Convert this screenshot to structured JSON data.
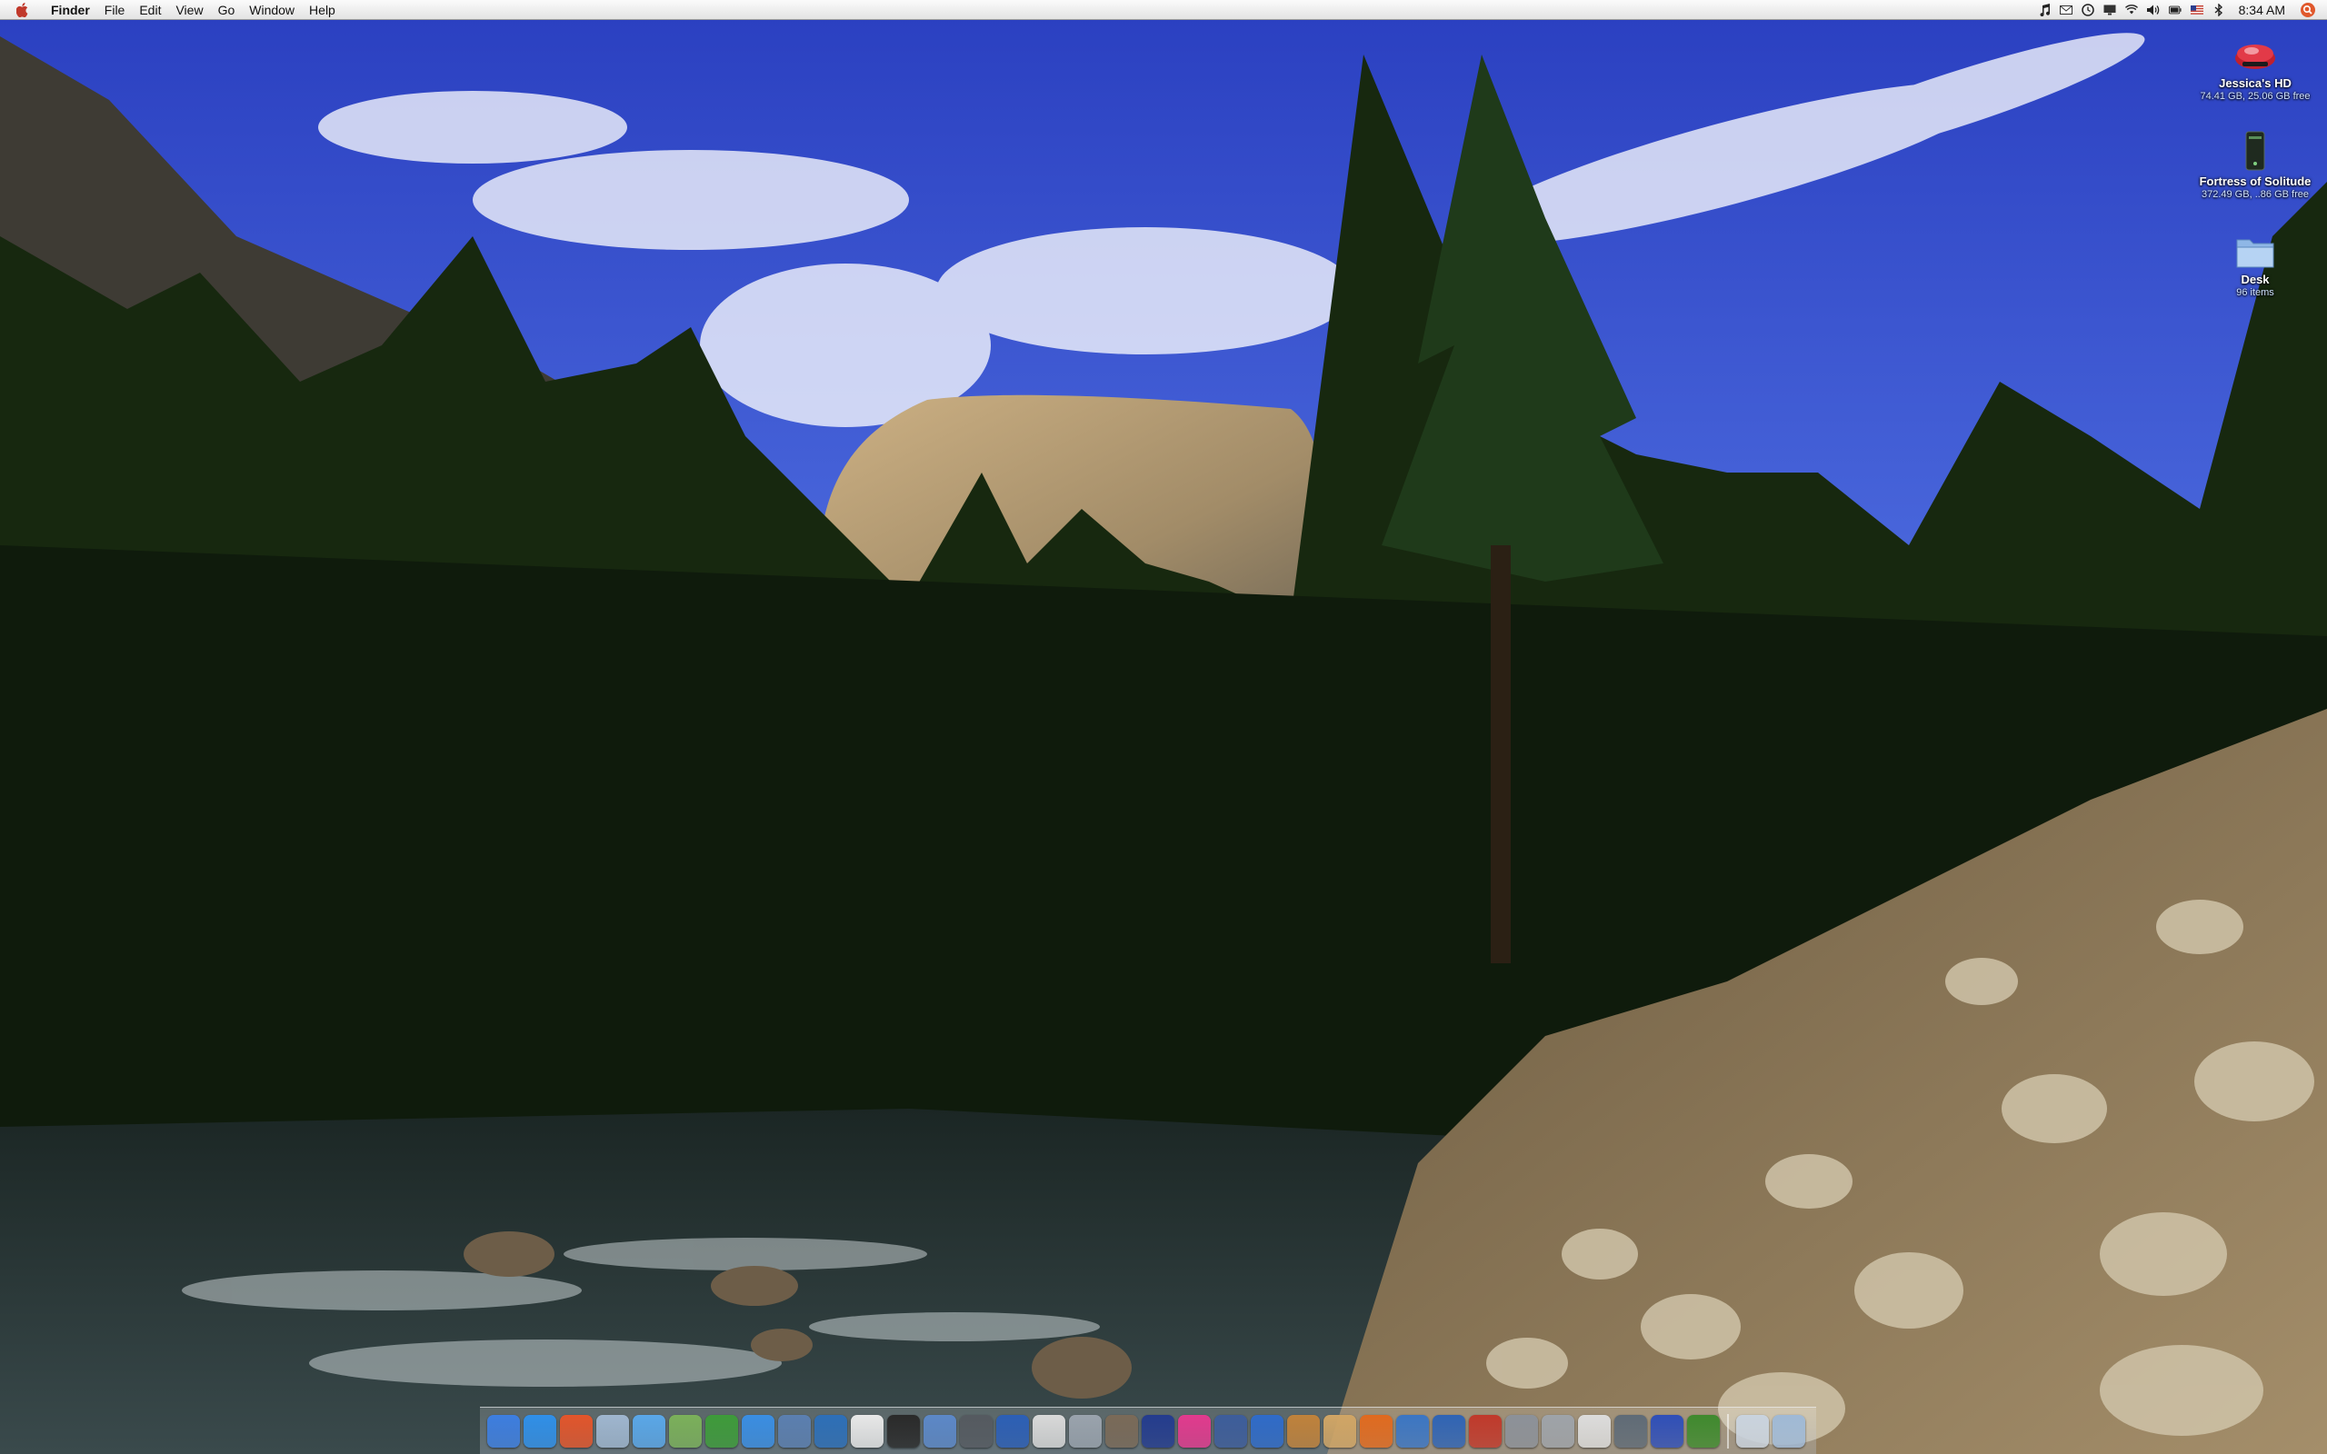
{
  "menubar": {
    "items": [
      "Finder",
      "File",
      "Edit",
      "View",
      "Go",
      "Window",
      "Help"
    ],
    "clock": "8:34 AM"
  },
  "status_icons": [
    "itunes-note-icon",
    "mail-icon",
    "time-machine-icon",
    "display-icon",
    "wifi-icon",
    "volume-icon",
    "battery-icon",
    "us-flag-icon",
    "bluetooth-icon",
    "spotlight-icon"
  ],
  "desktop_items": [
    {
      "name": "Jessica's HD",
      "info": "74.41 GB, 25.06 GB free",
      "icon": "hard-drive-icon"
    },
    {
      "name": "Fortress of Solitude",
      "info": "372.49 GB, ..86 GB free",
      "icon": "external-drive-icon"
    },
    {
      "name": "Desk",
      "info": "96 items",
      "icon": "folder-icon"
    }
  ],
  "dock_apps": [
    {
      "name": "finder-icon",
      "color": "#3d7ee0"
    },
    {
      "name": "safari-icon",
      "color": "#2f8fe8"
    },
    {
      "name": "fruit-app-icon",
      "color": "#e2552b"
    },
    {
      "name": "mail-icon",
      "color": "#9fb6cf"
    },
    {
      "name": "itunes-icon",
      "color": "#5aa7e8"
    },
    {
      "name": "script-editor-icon",
      "color": "#7bb05a"
    },
    {
      "name": "adium-duck-icon",
      "color": "#3e9b3a"
    },
    {
      "name": "ichat-icon",
      "color": "#3a8ee3"
    },
    {
      "name": "preview-icon",
      "color": "#5b7fb0"
    },
    {
      "name": "photo-browser-icon",
      "color": "#2d6fb8"
    },
    {
      "name": "ical-icon",
      "color": "#e8e8e8"
    },
    {
      "name": "dvd-player-icon",
      "color": "#2a2a2a"
    },
    {
      "name": "iphoto-icon",
      "color": "#5c88c8"
    },
    {
      "name": "nx-icon",
      "color": "#555a60"
    },
    {
      "name": "xcode-icon",
      "color": "#2c5fb6"
    },
    {
      "name": "textedit-icon",
      "color": "#d9d9d9"
    },
    {
      "name": "disk-utility-icon",
      "color": "#9aa3ad"
    },
    {
      "name": "image-capture-icon",
      "color": "#7a6a58"
    },
    {
      "name": "star-app-icon",
      "color": "#243c8e"
    },
    {
      "name": "flower-app-icon",
      "color": "#e23a8e"
    },
    {
      "name": "imovie-icon",
      "color": "#3d5d9b"
    },
    {
      "name": "stopwatch-icon",
      "color": "#2f6bc9"
    },
    {
      "name": "pencil-app-icon",
      "color": "#c0823b"
    },
    {
      "name": "photoshop-icon",
      "color": "#d0a565"
    },
    {
      "name": "firefox-icon",
      "color": "#e06a1f"
    },
    {
      "name": "network-app-icon",
      "color": "#3b76c4"
    },
    {
      "name": "books-app-icon",
      "color": "#2f64b5"
    },
    {
      "name": "dictionary-icon",
      "color": "#c0392b"
    },
    {
      "name": "system-prefs-icon",
      "color": "#8c9199"
    },
    {
      "name": "calculator-icon",
      "color": "#9ea3a9"
    },
    {
      "name": "ipod-icon",
      "color": "#dcdcdc"
    },
    {
      "name": "disc-app-icon",
      "color": "#5f6b77"
    },
    {
      "name": "w-app-icon",
      "color": "#2f4fb8"
    },
    {
      "name": "tree-app-icon",
      "color": "#3f8a2e"
    }
  ],
  "dock_stacks": [
    {
      "name": "documents-stack-icon",
      "color": "#c9d3de"
    },
    {
      "name": "trash-icon",
      "color": "#9fb9d6"
    }
  ]
}
